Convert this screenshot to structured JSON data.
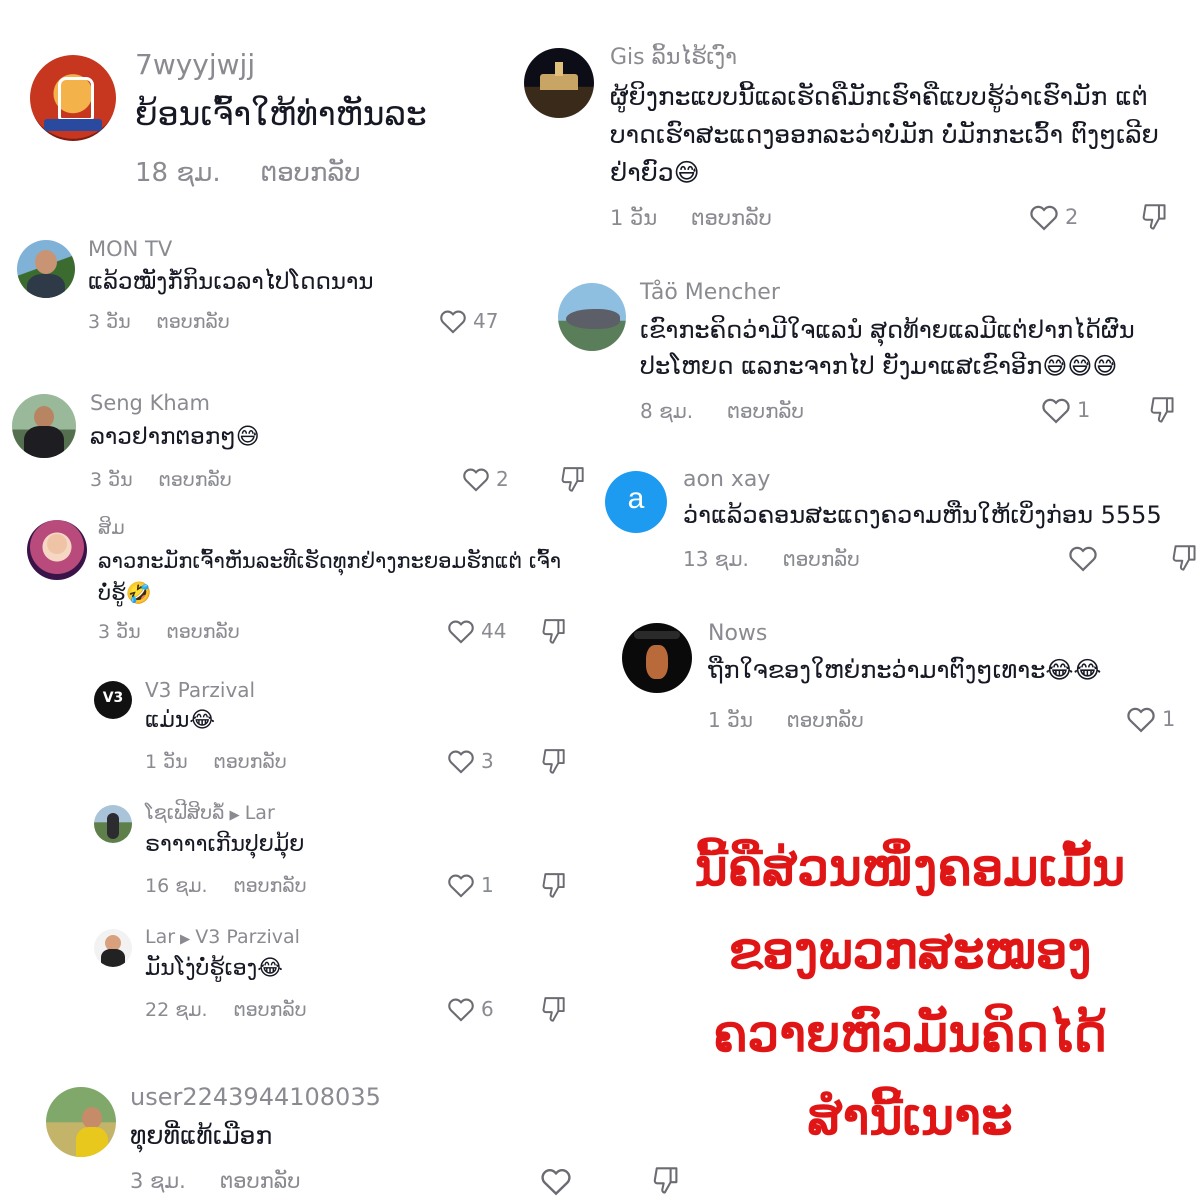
{
  "comments": [
    {
      "username": "7wyyjwjj",
      "text": "ຍ້ອນເຈົ້າໃຫ້ທ່າຫັນລະ",
      "time": "18 ຊມ.",
      "reply": "ຕອບກລັບ"
    },
    {
      "username": "MON TV",
      "text": "ແລ້ວໝັງກໍ້ກິນເວລາໄປໂດດນານ",
      "time": "3 ວັນ",
      "reply": "ຕອບກລັບ",
      "likes": "47"
    },
    {
      "username": "Seng Kham",
      "text": "ລາວຢາກຕອກໆ😅",
      "time": "3 ວັນ",
      "reply": "ຕອບກລັບ",
      "likes": "2"
    },
    {
      "username": "ສິມ",
      "text": "ລາວກະມັກເຈົ້າຫັນລະທີເຮັດທຸກຢ່າງກະຍອມຮັກແຕ່ ເຈົ້າບໍ່ຮູ້🤣",
      "time": "3 ວັນ",
      "reply": "ຕອບກລັບ",
      "likes": "44"
    },
    {
      "username": "V3 Parzival",
      "text": "ແມ່ນ😂",
      "time": "1 ວັນ",
      "reply": "ຕອບກລັບ",
      "likes": "3"
    },
    {
      "username": "ໂຊເຟີສິບລໍ້",
      "reply_to": "Lar",
      "text": "ຣາາາາເກີນປຸຍມຸ້ຍ",
      "time": "16 ຊມ.",
      "reply": "ຕອບກລັບ",
      "likes": "1"
    },
    {
      "username": "Lar",
      "reply_to": "V3 Parzival",
      "text": "ມັນໂງ່ບໍ່ຮູ້ເອງ😂",
      "time": "22 ຊມ.",
      "reply": "ຕອບກລັບ",
      "likes": "6"
    },
    {
      "username": "user2243944108035",
      "text": "ທຸຍທີ່ແທ້ເມືອກ",
      "time": "3 ຊມ.",
      "reply": "ຕອບກລັບ"
    },
    {
      "username": "Gis ລິ້ນໄຮ້ເງົາ",
      "text": "ຜູ້ຍິງກະແບບນີ້ແລເຮັດຄືມັກເຮົາຄືແບບຮູ້ວ່າເຮົາມັກ ແຕ່ບາດເຮົາສະແດງອອກລະວ່າບໍ່ມັກ ບໍ່ມັກກະເວົ້າ ຕົງໆເລີຍຢ່າຍົວ😅",
      "time": "1 ວັນ",
      "reply": "ຕອບກລັບ",
      "likes": "2"
    },
    {
      "username": "Tåö Mencher",
      "text": "ເຂົາກະຄິດວ່າມີໃຈແລນໍ ສຸດທ້າຍແລມີແຕ່ຢາກໄດ້ຜົນ ປະໂຫຍດ ແລກະຈາກໄປ ຍັງມາແສເຂົາອີກ😅😅😅",
      "time": "8 ຊມ.",
      "reply": "ຕອບກລັບ",
      "likes": "1"
    },
    {
      "username": "aon xay",
      "avatar_letter": "a",
      "text": "ວ່າແລ້ວຄອນສະແດງຄວາມຫືນໃຫ້ເບິ່ງກ່ອນ 5555",
      "time": "13 ຊມ.",
      "reply": "ຕອບກລັບ"
    },
    {
      "username": "Nows",
      "text": "ຖືກໃຈຂອງໃຫຍ່ກະວ່າມາຕົງໆເທາະ😂😂",
      "time": "1 ວັນ",
      "reply": "ຕອບກລັບ",
      "likes": "1"
    }
  ],
  "overlay_lines": [
    "ນີ້ຄືສ່ວນໜຶ່ງຄອມເມັ້ນ",
    "ຂອງພວກສະໝອງ",
    "ຄວາຍຫົວມັນຄິດໄດ້",
    "ສຳນີ້ເນາະ"
  ],
  "colors": {
    "overlay": "#e01515",
    "meta": "#8a8b91",
    "avatar_letter_bg": "#1d9bf0"
  }
}
